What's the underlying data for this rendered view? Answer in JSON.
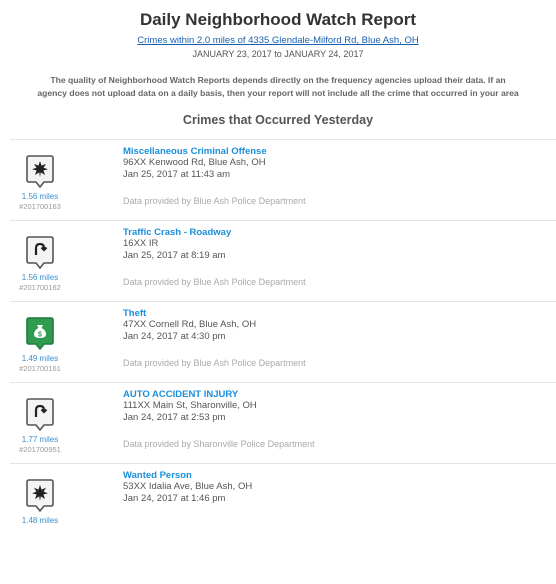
{
  "header": {
    "title": "Daily Neighborhood Watch Report",
    "subtitle_link": "Crimes within 2.0 miles of 4335 Glendale-Milford Rd, Blue Ash, OH",
    "date_range": "JANUARY 23, 2017 to JANUARY 24, 2017"
  },
  "notice": {
    "line1": "The quality of Neighborhood Watch Reports depends directly on the frequency agencies upload their data. If an",
    "line2": "agency does not upload data on a daily basis, then your report will not include all the crime that occurred in your area"
  },
  "section_title": "Crimes that Occurred Yesterday",
  "crimes": [
    {
      "icon": "burst-icon",
      "badge_color": "#555555",
      "type": "Miscellaneous Criminal Offense",
      "address": "96XX Kenwood Rd, Blue Ash, OH",
      "datetime": "Jan 25, 2017 at 11:43 am",
      "distance": "1.56 miles",
      "report_id": "#201700163",
      "provider": "Data provided by Blue Ash Police Department"
    },
    {
      "icon": "car-crash-icon",
      "badge_color": "#555555",
      "type": "Traffic Crash - Roadway",
      "address": "16XX IR",
      "datetime": "Jan 25, 2017 at 8:19 am",
      "distance": "1.56 miles",
      "report_id": "#201700162",
      "provider": "Data provided by Blue Ash Police Department"
    },
    {
      "icon": "money-bag-icon",
      "badge_color": "#2e9b4f",
      "type": "Theft",
      "address": "47XX Cornell Rd, Blue Ash, OH",
      "datetime": "Jan 24, 2017 at 4:30 pm",
      "distance": "1.49 miles",
      "report_id": "#201700161",
      "provider": "Data provided by Blue Ash Police Department"
    },
    {
      "icon": "car-crash-icon",
      "badge_color": "#555555",
      "type": "AUTO ACCIDENT INJURY",
      "address": "111XX Main St, Sharonville, OH",
      "datetime": "Jan 24, 2017 at 2:53 pm",
      "distance": "1.77 miles",
      "report_id": "#201700951",
      "provider": "Data provided by Sharonville Police Department"
    },
    {
      "icon": "burst-icon",
      "badge_color": "#555555",
      "type": "Wanted Person",
      "address": "53XX Idalia Ave, Blue Ash, OH",
      "datetime": "Jan 24, 2017 at 1:46 pm",
      "distance": "1.48 miles",
      "report_id": "",
      "provider": ""
    }
  ]
}
